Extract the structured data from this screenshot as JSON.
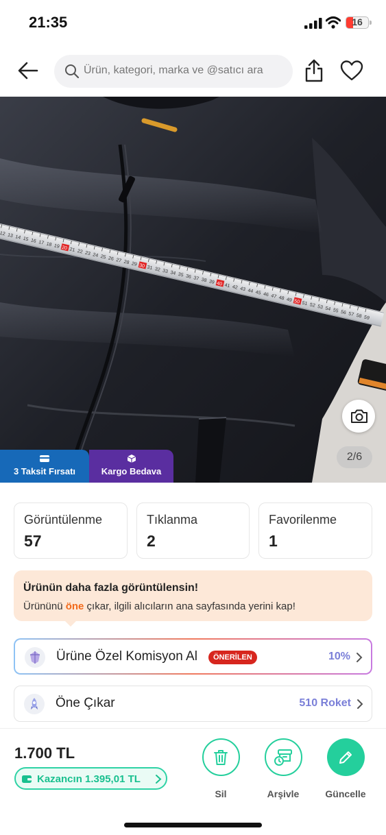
{
  "status_bar": {
    "time": "21:35",
    "battery": "16",
    "battery_color": "#ff3b30"
  },
  "header": {
    "search_placeholder": "Ürün, kategori, marka ve @satıcı ara",
    "icons": {
      "back": "arrow-left-icon",
      "search": "magnifier-icon",
      "share": "share-icon",
      "favorite": "heart-icon"
    }
  },
  "photo": {
    "counter": "2/6",
    "badges": [
      {
        "label": "3 Taksit Fırsatı",
        "icon": "credit-card-icon",
        "color": "#1769b8"
      },
      {
        "label": "Kargo Bedava",
        "icon": "box-icon",
        "color": "#5a2ea0"
      }
    ],
    "ruler_numbers": [
      "12",
      "13",
      "14",
      "15",
      "16",
      "17",
      "18",
      "19",
      "20",
      "21",
      "22",
      "23",
      "24",
      "25",
      "26",
      "27",
      "28",
      "29",
      "30",
      "31",
      "32",
      "33",
      "34",
      "35",
      "36",
      "37",
      "38",
      "39",
      "40",
      "41",
      "42",
      "43",
      "44",
      "45",
      "46",
      "47",
      "48",
      "49",
      "50",
      "51",
      "52",
      "53",
      "54",
      "55",
      "56",
      "57",
      "58",
      "59"
    ],
    "ruler_highlights": [
      "20",
      "30",
      "40",
      "50"
    ]
  },
  "stats": [
    {
      "label": "Görüntülenme",
      "value": "57"
    },
    {
      "label": "Tıklanma",
      "value": "2"
    },
    {
      "label": "Favorilenme",
      "value": "1"
    }
  ],
  "promo": {
    "title": "Ürünün daha fazla görüntülensin!",
    "desc_before": "Ürününü ",
    "desc_highlight": "öne",
    "desc_after": " çıkar, ilgili alıcıların ana sayfasında yerini kap!"
  },
  "rows": {
    "komisyon": {
      "label": "Ürüne Özel Komisyon Al",
      "tag": "ÖNERİLEN",
      "value": "10%"
    },
    "one_cikar": {
      "label": "Öne Çıkar",
      "value": "510 Roket"
    }
  },
  "bottom": {
    "price": "1.700 TL",
    "earn": "Kazancın 1.395,01 TL",
    "actions": {
      "delete": "Sil",
      "archive": "Arşivle",
      "update": "Güncelle"
    }
  },
  "colors": {
    "accent_green": "#24cf9c",
    "accent_purple": "#7a7fd8",
    "promo_bg": "#fde8d8",
    "tag_red": "#d7261e"
  }
}
